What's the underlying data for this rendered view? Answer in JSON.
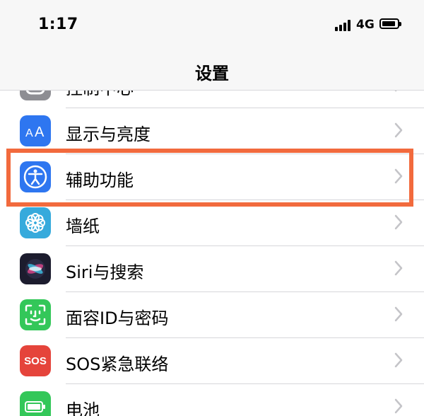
{
  "status_bar": {
    "time": "1:17",
    "network": "4G",
    "battery_icon": "battery-icon",
    "signal_icon": "signal-icon"
  },
  "nav": {
    "title": "设置"
  },
  "rows": [
    {
      "label": "控制中心",
      "icon": "control-center-icon",
      "color": "#8e8e93"
    },
    {
      "label": "显示与亮度",
      "icon": "display-brightness-icon",
      "color": "#2e76f0"
    },
    {
      "label": "辅助功能",
      "icon": "accessibility-icon",
      "color": "#2e76f0"
    },
    {
      "label": "墙纸",
      "icon": "wallpaper-icon",
      "color": "#36aadc"
    },
    {
      "label": "Siri与搜索",
      "icon": "siri-icon",
      "color": "#1c1c2e"
    },
    {
      "label": "面容ID与密码",
      "icon": "face-id-icon",
      "color": "#33c759"
    },
    {
      "label": "SOS紧急联络",
      "icon": "sos-icon",
      "color": "#e5443b"
    },
    {
      "label": "电池",
      "icon": "battery-settings-icon",
      "color": "#33c759"
    }
  ],
  "sos_icon_text": "SOS",
  "highlight": {
    "target": "辅助功能",
    "color": "#f26a3d"
  }
}
